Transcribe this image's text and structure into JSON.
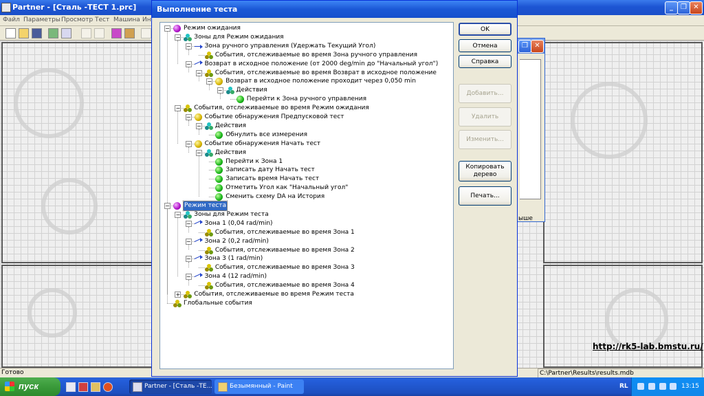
{
  "app": {
    "title": "Partner - [Сталь -ТЕСТ 1.prc]",
    "menu": [
      "Файл",
      "Параметры",
      "Просмотр",
      "Тест",
      "Машина",
      "Ин"
    ],
    "status_left": "Готово",
    "status_right": "C:\\Partner\\Results\\results.mdb",
    "watermark": "http://rk5-lab.bmstu.ru/",
    "background_window_text": "ыше"
  },
  "dialog": {
    "title": "Выполнение теста",
    "buttons": {
      "ok": "OK",
      "cancel": "Отмена",
      "help": "Справка",
      "add": "Добавить...",
      "delete": "Удалить",
      "edit": "Изменить...",
      "copy_tree": "Копировать дерево",
      "print": "Печать..."
    },
    "tree": [
      {
        "level": 0,
        "icon": "purple",
        "expander": "-",
        "label": "Режим ожидания"
      },
      {
        "level": 1,
        "icon": "cluster-cyan",
        "expander": "-",
        "label": "Зоны для Режим ожидания"
      },
      {
        "level": 2,
        "icon": "arrow-flat",
        "expander": "-",
        "label": "Зона ручного управления (Удержать Текущий Угол)"
      },
      {
        "level": 3,
        "icon": "cluster-olive",
        "expander": "",
        "label": "События, отслеживаемые во время Зона ручного управления"
      },
      {
        "level": 2,
        "icon": "arrow",
        "expander": "-",
        "label": "Возврат в исходное положение (от 2000 deg/min до \"Начальный угол\")"
      },
      {
        "level": 3,
        "icon": "cluster-olive",
        "expander": "-",
        "label": "События, отслеживаемые во время Возврат в исходное положение"
      },
      {
        "level": 4,
        "icon": "yellow",
        "expander": "-",
        "label": "Возврат в исходное положение проходит через 0,050 min"
      },
      {
        "level": 5,
        "icon": "cluster-cyan",
        "expander": "-",
        "label": "Действия"
      },
      {
        "level": 6,
        "icon": "green",
        "expander": "",
        "label": "Перейти к Зона ручного управления"
      },
      {
        "level": 1,
        "icon": "cluster-olive",
        "expander": "-",
        "label": "События, отслеживаемые во время Режим ожидания"
      },
      {
        "level": 2,
        "icon": "yellow",
        "expander": "-",
        "label": "Событие обнаружения Предпусковой тест"
      },
      {
        "level": 3,
        "icon": "cluster-cyan",
        "expander": "-",
        "label": "Действия"
      },
      {
        "level": 4,
        "icon": "green",
        "expander": "",
        "label": "Обнулить все измерения"
      },
      {
        "level": 2,
        "icon": "yellow",
        "expander": "-",
        "label": "Событие обнаружения Начать тест"
      },
      {
        "level": 3,
        "icon": "cluster-cyan",
        "expander": "-",
        "label": "Действия"
      },
      {
        "level": 4,
        "icon": "green",
        "expander": "",
        "label": "Перейти к Зона 1"
      },
      {
        "level": 4,
        "icon": "green",
        "expander": "",
        "label": "Записать дату Начать тест"
      },
      {
        "level": 4,
        "icon": "green",
        "expander": "",
        "label": "Записать время Начать тест"
      },
      {
        "level": 4,
        "icon": "green",
        "expander": "",
        "label": "Отметить Угол как \"Начальный угол\""
      },
      {
        "level": 4,
        "icon": "green",
        "expander": "",
        "label": "Сменить схему DA на История"
      },
      {
        "level": 0,
        "icon": "purple",
        "expander": "-",
        "label": "Режим теста",
        "selected": true
      },
      {
        "level": 1,
        "icon": "cluster-cyan",
        "expander": "-",
        "label": "Зоны для Режим теста"
      },
      {
        "level": 2,
        "icon": "arrow",
        "expander": "-",
        "label": "Зона 1 (0,04 rad/min)"
      },
      {
        "level": 3,
        "icon": "cluster-olive",
        "expander": "",
        "label": "События, отслеживаемые во время Зона 1"
      },
      {
        "level": 2,
        "icon": "arrow",
        "expander": "-",
        "label": "Зона 2 (0,2 rad/min)"
      },
      {
        "level": 3,
        "icon": "cluster-olive",
        "expander": "",
        "label": "События, отслеживаемые во время Зона 2"
      },
      {
        "level": 2,
        "icon": "arrow",
        "expander": "-",
        "label": "Зона 3 (1 rad/min)"
      },
      {
        "level": 3,
        "icon": "cluster-olive",
        "expander": "",
        "label": "События, отслеживаемые во время Зона 3"
      },
      {
        "level": 2,
        "icon": "arrow",
        "expander": "-",
        "label": "Зона 4 (12 rad/min)"
      },
      {
        "level": 3,
        "icon": "cluster-olive",
        "expander": "",
        "label": "События, отслеживаемые во время Зона 4"
      },
      {
        "level": 1,
        "icon": "cluster-olive",
        "expander": "+",
        "label": "События, отслеживаемые во время Режим теста"
      },
      {
        "level": 0,
        "icon": "cluster-olive",
        "expander": "",
        "label": "Глобальные события"
      }
    ]
  },
  "taskbar": {
    "start": "пуск",
    "tasks": [
      "Partner - [Сталь -ТЕ...",
      "Безымянный - Paint"
    ],
    "language": "RL",
    "clock": "13:15"
  }
}
